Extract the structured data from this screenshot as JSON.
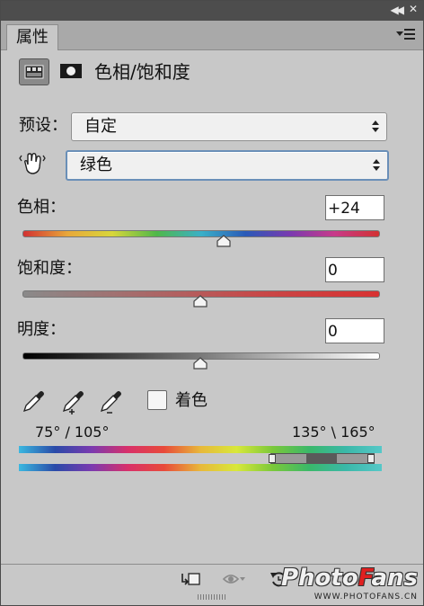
{
  "tab": {
    "label": "属性"
  },
  "header": {
    "title": "色相/饱和度"
  },
  "preset": {
    "label": "预设：",
    "value": "自定"
  },
  "channel": {
    "value": "绿色"
  },
  "hue": {
    "label": "色相：",
    "value": "+24",
    "min": -180,
    "max": 180
  },
  "saturation": {
    "label": "饱和度：",
    "value": "0",
    "min": -100,
    "max": 100
  },
  "lightness": {
    "label": "明度：",
    "value": "0",
    "min": -100,
    "max": 100
  },
  "colorize": {
    "label": "着色",
    "checked": false
  },
  "range": {
    "left": "75° / 105°",
    "right": "135° \\ 165°"
  },
  "watermark": {
    "logo_a": "Photo",
    "logo_b": "F",
    "logo_c": "ans",
    "url": "WWW.PHOTOFANS.CN"
  },
  "icons": {
    "adjustment": "hue-saturation-adjustment-icon",
    "mask": "layer-mask-icon",
    "targeted_adjust": "hand-targeted-adjustment-icon",
    "droppers": [
      "eyedropper-icon",
      "eyedropper-plus-icon",
      "eyedropper-minus-icon"
    ],
    "footer": [
      "clip-to-layer-icon",
      "view-previous-state-icon",
      "reset-icon",
      "toggle-visibility-icon",
      "delete-icon"
    ]
  }
}
